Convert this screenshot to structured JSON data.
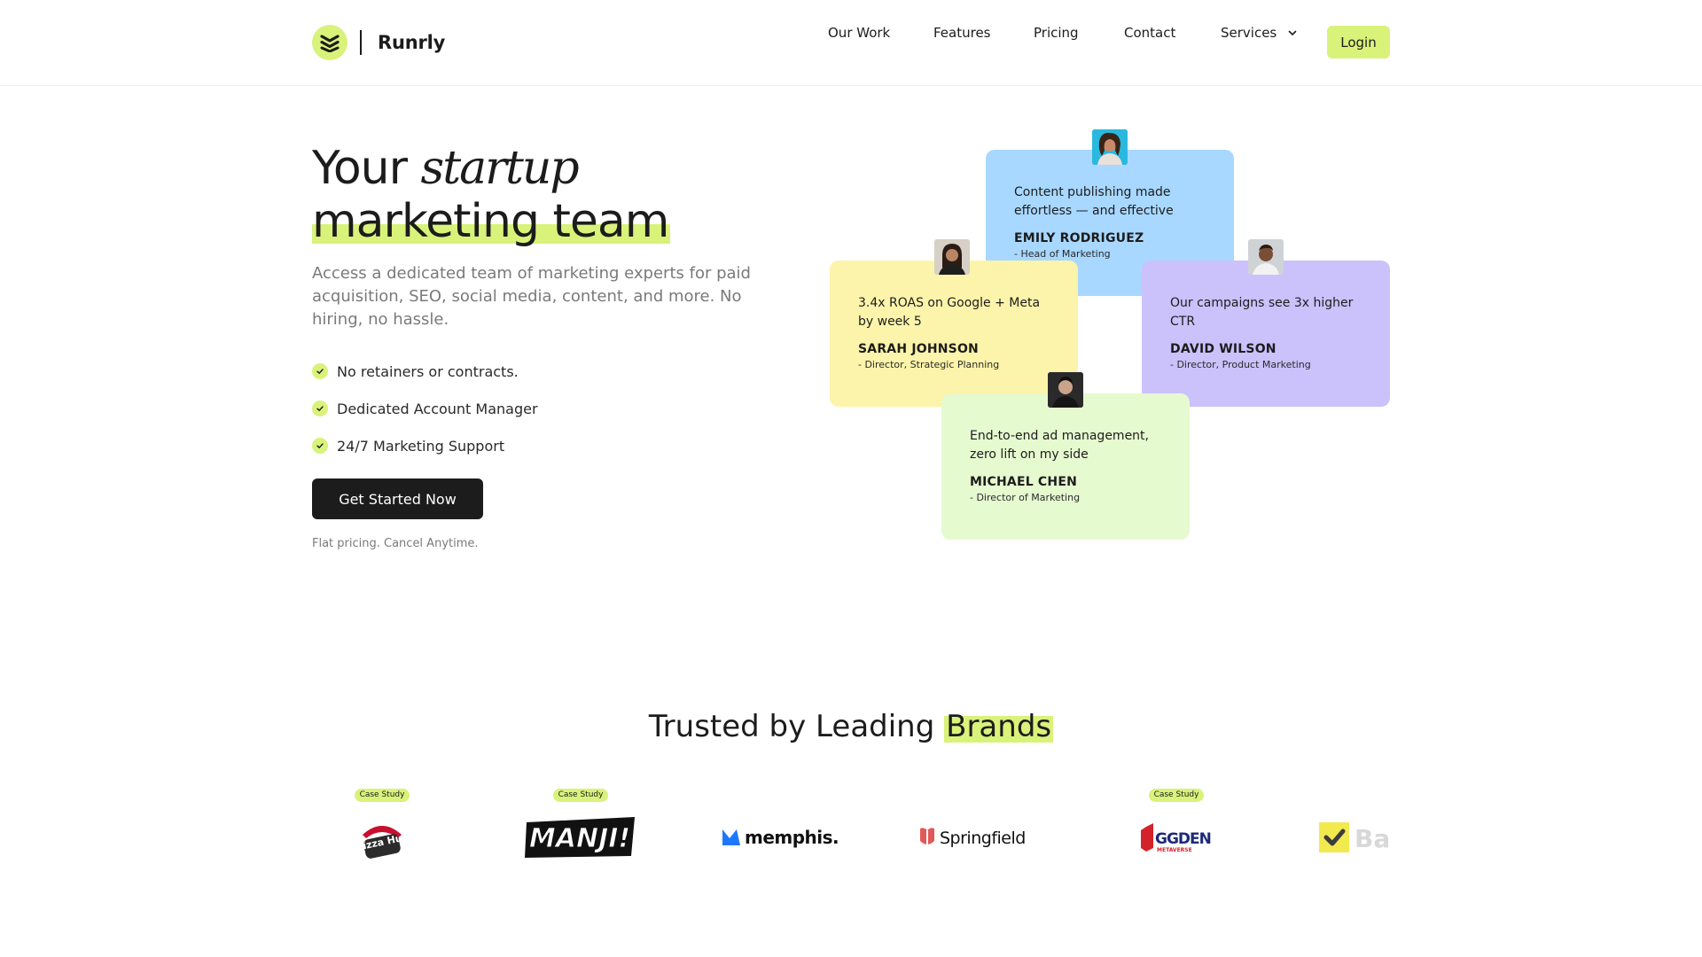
{
  "header": {
    "brand": "Runrly",
    "nav": [
      "Our Work",
      "Features",
      "Pricing",
      "Contact",
      "Services"
    ],
    "login": "Login"
  },
  "hero": {
    "title_word": "Your",
    "title_italic": "startup",
    "title_highlight": "marketing team",
    "subtitle": "Access a dedicated team of marketing experts for paid acquisition, SEO, social media, content, and more. No hiring, no hassle.",
    "features": [
      "No retainers or contracts.",
      "Dedicated Account Manager",
      "24/7 Marketing Support"
    ],
    "cta": "Get Started Now",
    "cta_note": "Flat pricing. Cancel Anytime."
  },
  "testimonials": [
    {
      "quote": "Content publishing made effortless — and effective",
      "name": "EMILY RODRIGUEZ",
      "role": "- Head of Marketing",
      "color": "#a8d8ff"
    },
    {
      "quote": "3.4x ROAS on Google + Meta by week 5",
      "name": "SARAH JOHNSON",
      "role": "- Director, Strategic Planning",
      "color": "#fcf4aa"
    },
    {
      "quote": "Our campaigns see 3x higher CTR",
      "name": "DAVID WILSON",
      "role": "- Director, Product Marketing",
      "color": "#cbc1fb"
    },
    {
      "quote": "End-to-end ad management, zero lift on my side",
      "name": "MICHAEL CHEN",
      "role": "- Director of Marketing",
      "color": "#e6fad0"
    }
  ],
  "trusted": {
    "title": "Trusted by Leading",
    "highlight": "Brands"
  },
  "brands": [
    {
      "name": "Pizza Hut",
      "badge": "Case Study"
    },
    {
      "name": "MANJI!",
      "badge": "Case Study"
    },
    {
      "name": "memphis.",
      "badge": ""
    },
    {
      "name": "Springfield",
      "badge": ""
    },
    {
      "name": "GGDEN",
      "sub": "METAVERSE",
      "badge": "Case Study"
    },
    {
      "name": "Ba",
      "badge": ""
    }
  ],
  "colors": {
    "accent": "#d9f27a",
    "dark": "#1c1c1c"
  }
}
